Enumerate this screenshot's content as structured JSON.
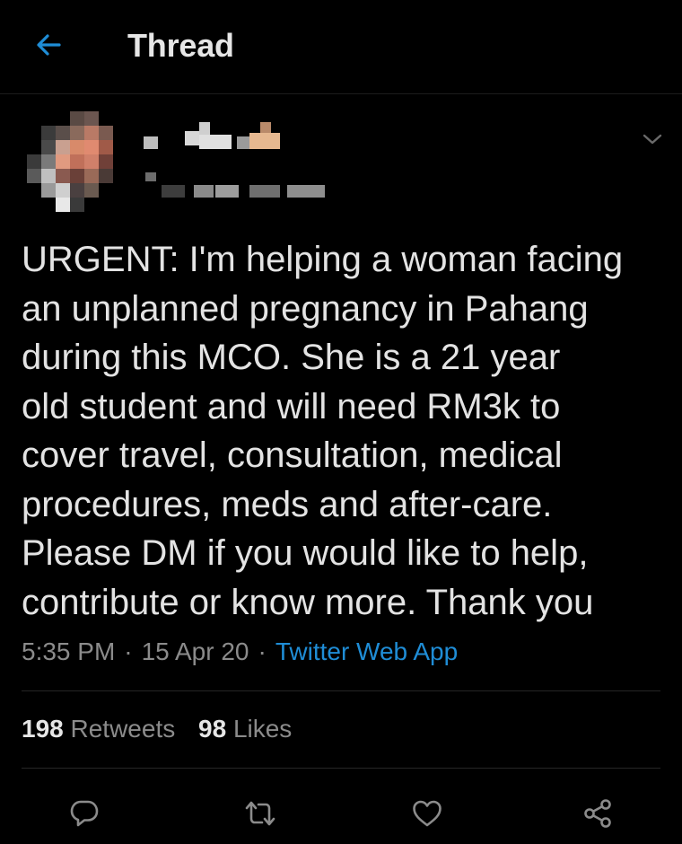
{
  "header": {
    "title": "Thread",
    "back_icon": "arrow-left-icon",
    "accent": "#1f8dd6"
  },
  "tweet": {
    "text": "URGENT: I'm helping a woman facing\nan unplanned pregnancy in Pahang\nduring this MCO. She is a 21 year\nold student and will need RM3k to\ncover travel, consultation, medical\nprocedures, meds and after-care.\nPlease DM if you would like to help,\ncontribute or know more. Thank you",
    "time": "5:35 PM",
    "date": "15 Apr 20",
    "separator": "·",
    "source": "Twitter Web App"
  },
  "stats": {
    "retweets_count": "198",
    "retweets_label": "Retweets",
    "likes_count": "98",
    "likes_label": "Likes"
  },
  "actions": {
    "reply_icon": "reply-icon",
    "retweet_icon": "retweet-icon",
    "like_icon": "heart-icon",
    "share_icon": "share-icon"
  },
  "colors": {
    "background": "#000000",
    "text": "#e3e3e3",
    "secondary": "#8b8b8b",
    "link": "#1f8dd6",
    "icon": "#8b8b8b"
  }
}
